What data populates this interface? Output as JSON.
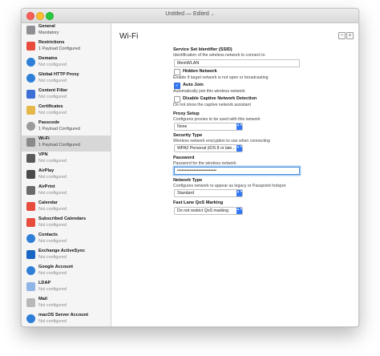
{
  "window": {
    "title": "Untitled — Edited",
    "title_chevron": "⌄"
  },
  "sidebar": {
    "items": [
      {
        "name": "General",
        "status": "Mandatory",
        "icon": "general-icon",
        "color": "#8e8e93"
      },
      {
        "name": "Restrictions",
        "status": "1 Payload Configured",
        "icon": "restrictions-icon",
        "color": "#e74c3c"
      },
      {
        "name": "Domains",
        "status": "Not configured",
        "icon": "globe-icon",
        "color": "#2f7fd8"
      },
      {
        "name": "Global HTTP Proxy",
        "status": "Not configured",
        "icon": "globe-icon",
        "color": "#2f7fd8"
      },
      {
        "name": "Content Filter",
        "status": "Not configured",
        "icon": "content-filter-icon",
        "color": "#3d6fd6"
      },
      {
        "name": "Certificates",
        "status": "Not configured",
        "icon": "certificate-icon",
        "color": "#e6b84a"
      },
      {
        "name": "Passcode",
        "status": "1 Payload Configured",
        "icon": "key-icon",
        "color": "#9b9b9b"
      },
      {
        "name": "Wi-Fi",
        "status": "1 Payload Configured",
        "icon": "wifi-icon",
        "color": "#8a8a8a"
      },
      {
        "name": "VPN",
        "status": "Not configured",
        "icon": "vpn-icon",
        "color": "#5a5a5a"
      },
      {
        "name": "AirPlay",
        "status": "Not configured",
        "icon": "airplay-icon",
        "color": "#4a4a4a"
      },
      {
        "name": "AirPrint",
        "status": "Not configured",
        "icon": "printer-icon",
        "color": "#6a6a6a"
      },
      {
        "name": "Calendar",
        "status": "Not configured",
        "icon": "calendar-icon",
        "color": "#e74c3c"
      },
      {
        "name": "Subscribed Calendars",
        "status": "Not configured",
        "icon": "subscribed-calendar-icon",
        "color": "#e74c3c"
      },
      {
        "name": "Contacts",
        "status": "Not configured",
        "icon": "globe-icon",
        "color": "#2f7fd8"
      },
      {
        "name": "Exchange ActiveSync",
        "status": "Not configured",
        "icon": "exchange-icon",
        "color": "#1a66c4"
      },
      {
        "name": "Google Account",
        "status": "Not configured",
        "icon": "globe-icon",
        "color": "#2f7fd8"
      },
      {
        "name": "LDAP",
        "status": "Not configured",
        "icon": "ldap-icon",
        "color": "#8fb6e6"
      },
      {
        "name": "Mail",
        "status": "Not configured",
        "icon": "mail-icon",
        "color": "#b8b8b8"
      },
      {
        "name": "macOS Server Account",
        "status": "Not configured",
        "icon": "globe-icon",
        "color": "#2f7fd8"
      }
    ],
    "selected_index": 7
  },
  "main": {
    "title": "Wi-Fi",
    "minus_label": "−",
    "plus_label": "+",
    "ssid": {
      "label": "Service Set Identifier (SSID)",
      "desc": "Identification of the wireless network to connect to",
      "value": "MeinWLAN"
    },
    "hidden": {
      "label": "Hidden Network",
      "desc": "Enable if target network is not open or broadcasting",
      "checked": false
    },
    "auto_join": {
      "label": "Auto Join",
      "desc": "Automatically join this wireless network",
      "checked": true,
      "check_glyph": "✓"
    },
    "captive": {
      "label": "Disable Captive Network Detection",
      "desc": "Do not show the captive network assistant",
      "checked": false
    },
    "proxy": {
      "label": "Proxy Setup",
      "desc": "Configures proxies to be used with this network",
      "value": "None"
    },
    "security": {
      "label": "Security Type",
      "desc": "Wireless network encryption to use when connecting",
      "value": "WPA2 Personal (iOS 8 or late..."
    },
    "password": {
      "label": "Password",
      "desc": "Password for the wireless network",
      "value": "••••••••••••••••••••••••••"
    },
    "network_type": {
      "label": "Network Type",
      "desc": "Configures network to appear as legacy or Passpoint hotspot",
      "value": "Standard"
    },
    "qos": {
      "label": "Fast Lane QoS Marking",
      "value": "Do not restrict QoS marking"
    },
    "select_arrows": "▲▼"
  },
  "colors": {
    "accent": "#3478f6",
    "selected_row": "#d7d7d7",
    "focus_ring": "#a9cdf4"
  }
}
